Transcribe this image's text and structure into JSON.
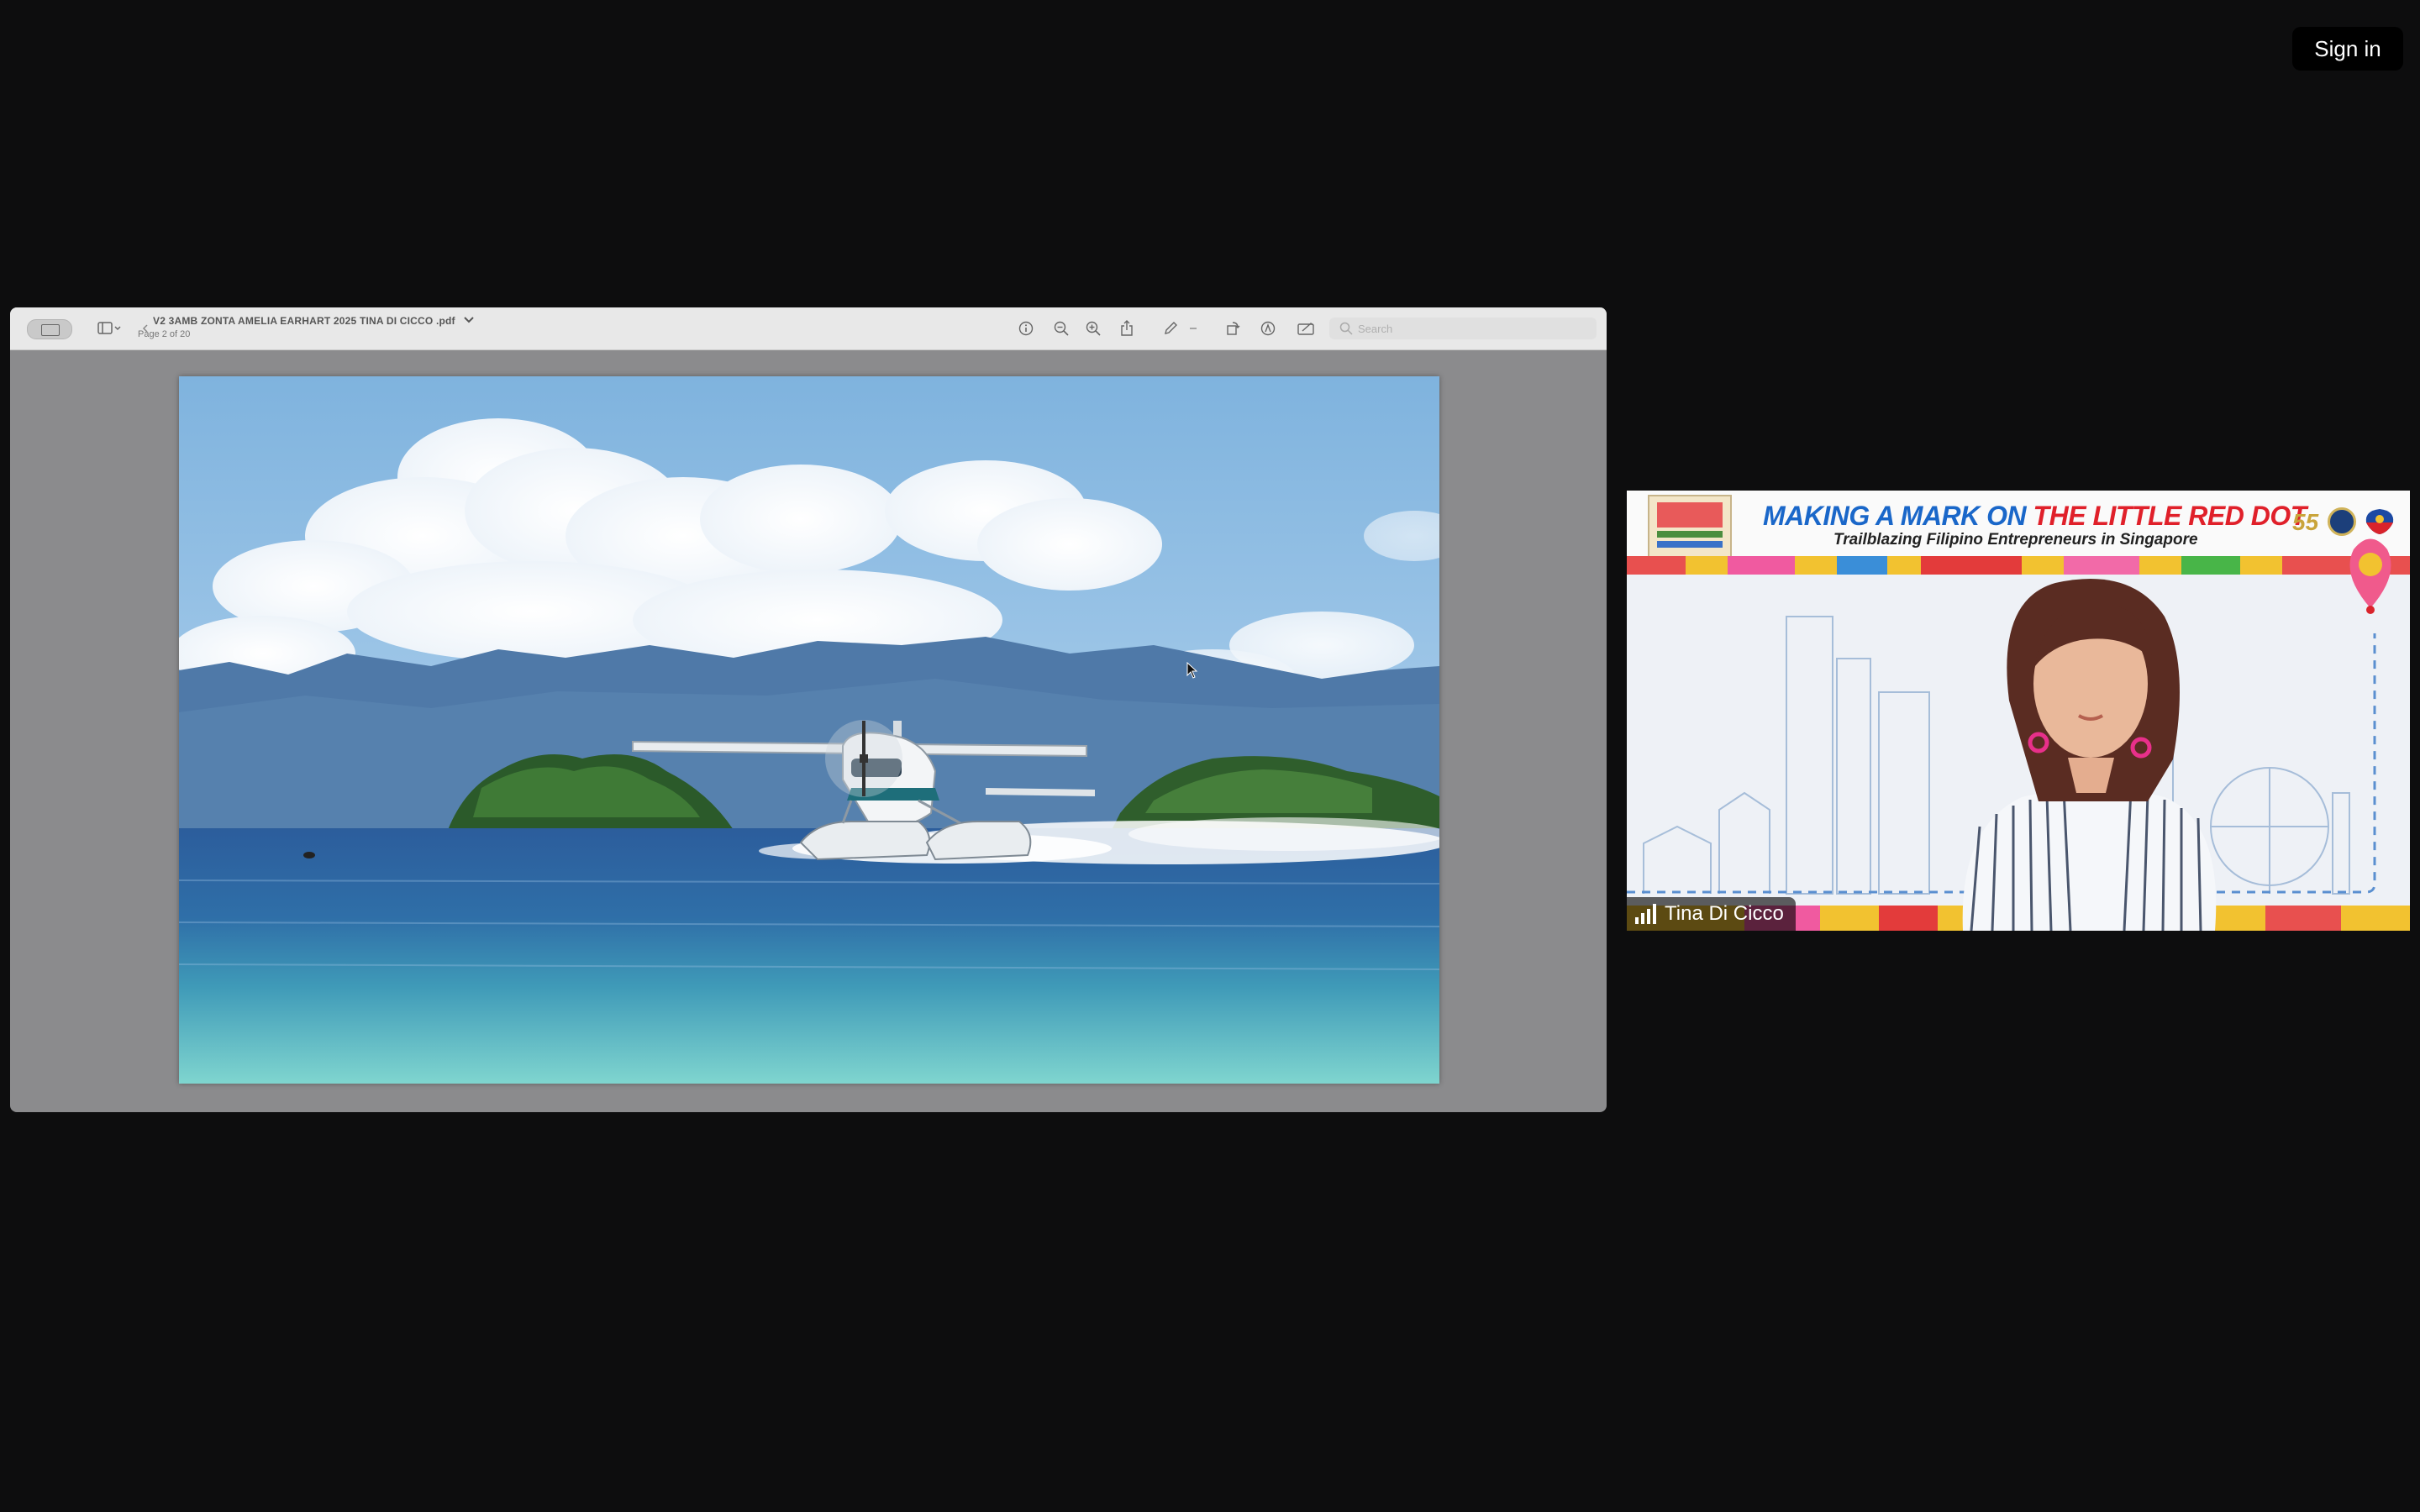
{
  "header": {
    "sign_in_label": "Sign in"
  },
  "pdf_viewer": {
    "title": "V2 3AMB ZONTA AMELIA EARHART 2025 TINA DI CICCO .pdf",
    "page_indicator": "Page 2 of 20",
    "search_placeholder": "Search",
    "toolbar_icons": [
      "sidebar-icon",
      "info-icon",
      "zoom-out-icon",
      "zoom-in-icon",
      "share-icon",
      "markup-pen-icon",
      "rotate-icon",
      "annotate-icon",
      "form-icon",
      "search-icon"
    ]
  },
  "video_tile": {
    "participant_name": "Tina Di Cicco",
    "banner_title_part1": "MAKING A MARK ON",
    "banner_title_part2": "THE LITTLE RED DOT",
    "banner_subtitle": "Trailblazing Filipino Entrepreneurs in Singapore",
    "badge_number": "55"
  },
  "colors": {
    "background": "#0d0d0e",
    "toolbar": "#e8e8e8",
    "banner_blue": "#1a67c9",
    "banner_red": "#e0202a"
  }
}
